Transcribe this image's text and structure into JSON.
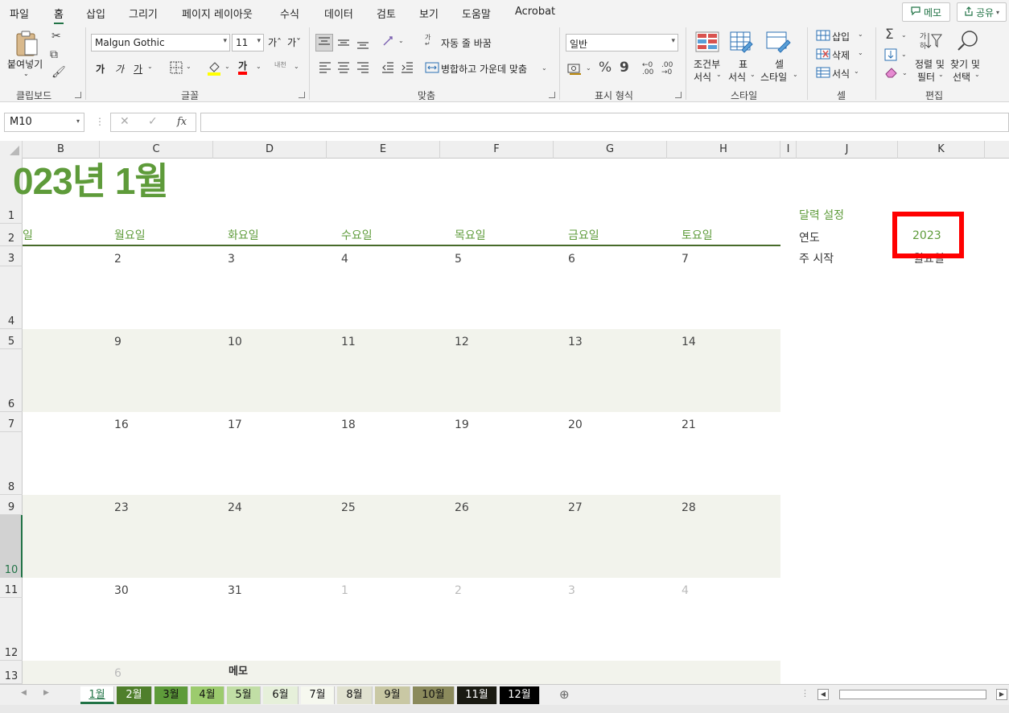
{
  "menu": {
    "items": [
      "파일",
      "홈",
      "삽입",
      "그리기",
      "페이지 레이아웃",
      "수식",
      "데이터",
      "검토",
      "보기",
      "도움말",
      "Acrobat"
    ],
    "active": "홈",
    "memo_label": "메모",
    "share_label": "공유"
  },
  "ribbon": {
    "clipboard": {
      "paste_label": "붙여넣기",
      "group_label": "클립보드"
    },
    "font": {
      "font_name": "Malgun Gothic",
      "font_size": "11",
      "bold": "가",
      "italic": "가",
      "underline": "가",
      "font_color_glyph": "가",
      "phonetic": "내천",
      "grow_font": "가ˆ",
      "shrink_font": "가ˇ",
      "group_label": "글꼴"
    },
    "alignment": {
      "wrap_label": "자동 줄 바꿈",
      "merge_label": "병합하고 가운데 맞춤",
      "group_label": "맞춤"
    },
    "number": {
      "format": "일반",
      "group_label": "표시 형식"
    },
    "styles": {
      "conditional_line1": "조건부",
      "conditional_line2": "서식",
      "table_line1": "표",
      "table_line2": "서식",
      "cell_line1": "셀",
      "cell_line2": "스타일",
      "group_label": "스타일"
    },
    "cells": {
      "insert": "삽입",
      "delete": "삭제",
      "format": "서식",
      "group_label": "셀"
    },
    "editing": {
      "sort_line1": "정렬 및",
      "sort_line2": "필터",
      "find_line1": "찾기 및",
      "find_line2": "선택",
      "group_label": "편집"
    }
  },
  "formula_bar": {
    "name_box": "M10",
    "cancel": "✕",
    "enter": "✓",
    "fx": "fx",
    "formula": ""
  },
  "columns": [
    "B",
    "C",
    "D",
    "E",
    "F",
    "G",
    "H",
    "I",
    "J",
    "K"
  ],
  "rows": [
    "1",
    "2",
    "3",
    "4",
    "5",
    "6",
    "7",
    "8",
    "9",
    "10",
    "11",
    "12",
    "13"
  ],
  "calendar": {
    "title": "023년 1월",
    "day_headers": [
      "일",
      "월요일",
      "화요일",
      "수요일",
      "목요일",
      "금요일",
      "토요일"
    ],
    "weeks": [
      [
        "2",
        "3",
        "4",
        "5",
        "6",
        "7"
      ],
      [
        "9",
        "10",
        "11",
        "12",
        "13",
        "14"
      ],
      [
        "16",
        "17",
        "18",
        "19",
        "20",
        "21"
      ],
      [
        "23",
        "24",
        "25",
        "26",
        "27",
        "28"
      ],
      [
        "30",
        "31",
        "1",
        "2",
        "3",
        "4"
      ]
    ],
    "memo_row_date": "6",
    "memo_label": "메모"
  },
  "settings": {
    "section_label": "달력 설정",
    "year_label": "연도",
    "year_value": "2023",
    "week_start_label": "주 시작",
    "week_start_value": "월요일"
  },
  "sheets": [
    "1월",
    "2월",
    "3월",
    "4월",
    "5월",
    "6월",
    "7월",
    "8월",
    "9월",
    "10월",
    "11월",
    "12월"
  ],
  "active_sheet": "1월",
  "sheet_colors": [
    "#e8f1e0",
    "#4f7f2b",
    "#5e9b3a",
    "#9ccb6e",
    "#c1dea5",
    "#e6f0da",
    "#f6f8ef",
    "#e1e2d0",
    "#c9c8a4",
    "#8b8a5c",
    "#1a1a12",
    "#000000"
  ],
  "sheet_text_colors": [
    "#333",
    "#fff",
    "#111",
    "#111",
    "#111",
    "#111",
    "#111",
    "#111",
    "#111",
    "#111",
    "#fff",
    "#fff"
  ],
  "colors": {
    "accent_green": "#5e9b3a",
    "header_line": "#476b2a",
    "band": "#f2f3ec",
    "highlight": "#ff0000",
    "excel_green": "#217346"
  }
}
